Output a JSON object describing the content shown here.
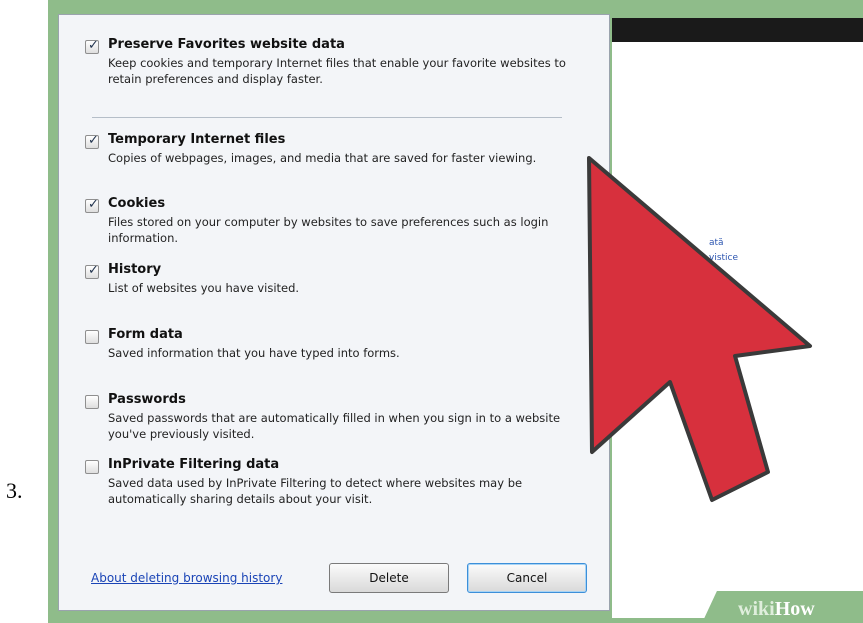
{
  "step_number": "3.",
  "options": [
    {
      "checked": true,
      "title": "Preserve Favorites website data",
      "description": "Keep cookies and temporary Internet files that enable your favorite websites to retain preferences and display faster."
    },
    {
      "checked": true,
      "title": "Temporary Internet files",
      "description": "Copies of webpages, images, and media that are saved for faster viewing."
    },
    {
      "checked": true,
      "title": "Cookies",
      "description": "Files stored on your computer by websites to save preferences such as login information."
    },
    {
      "checked": true,
      "title": "History",
      "description": "List of websites you have visited."
    },
    {
      "checked": false,
      "title": "Form data",
      "description": "Saved information that you have typed into forms."
    },
    {
      "checked": false,
      "title": "Passwords",
      "description": "Saved passwords that are automatically filled in when you sign in to a website you've previously visited."
    },
    {
      "checked": false,
      "title": "InPrivate Filtering data",
      "description": "Saved data used by InPrivate Filtering to detect where websites may be automatically sharing details about your visit."
    }
  ],
  "footer": {
    "about_link": "About deleting browsing history",
    "delete_label": "Delete",
    "cancel_label": "Cancel"
  },
  "check_glyph": "✓",
  "background_page": {
    "link_1": "ată",
    "link_2": "vistice"
  },
  "watermark": {
    "part_1": "wiki",
    "part_2": "How"
  },
  "colors": {
    "arrow": "#d7303d",
    "frame": "#8fbc8a",
    "link": "#1a44b6"
  }
}
